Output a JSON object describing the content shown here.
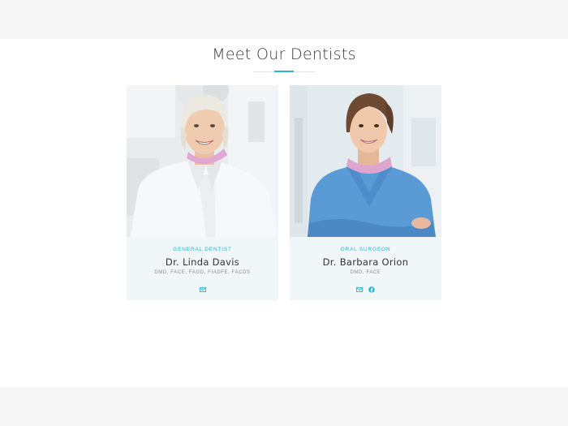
{
  "section": {
    "title": "Meet Our Dentists",
    "accent_color": "#2bb5d1"
  },
  "dentists": [
    {
      "role": "GENERAL DENTIST",
      "name": "Dr. Linda Davis",
      "credentials": "DMD, FACE, FAGD, FIADFE, FACDS",
      "social_icons": [
        "envelope-icon"
      ]
    },
    {
      "role": "ORAL SURGEON",
      "name": "Dr. Barbara Orion",
      "credentials": "DMD, FACE",
      "social_icons": [
        "envelope-icon",
        "facebook-icon"
      ]
    }
  ]
}
